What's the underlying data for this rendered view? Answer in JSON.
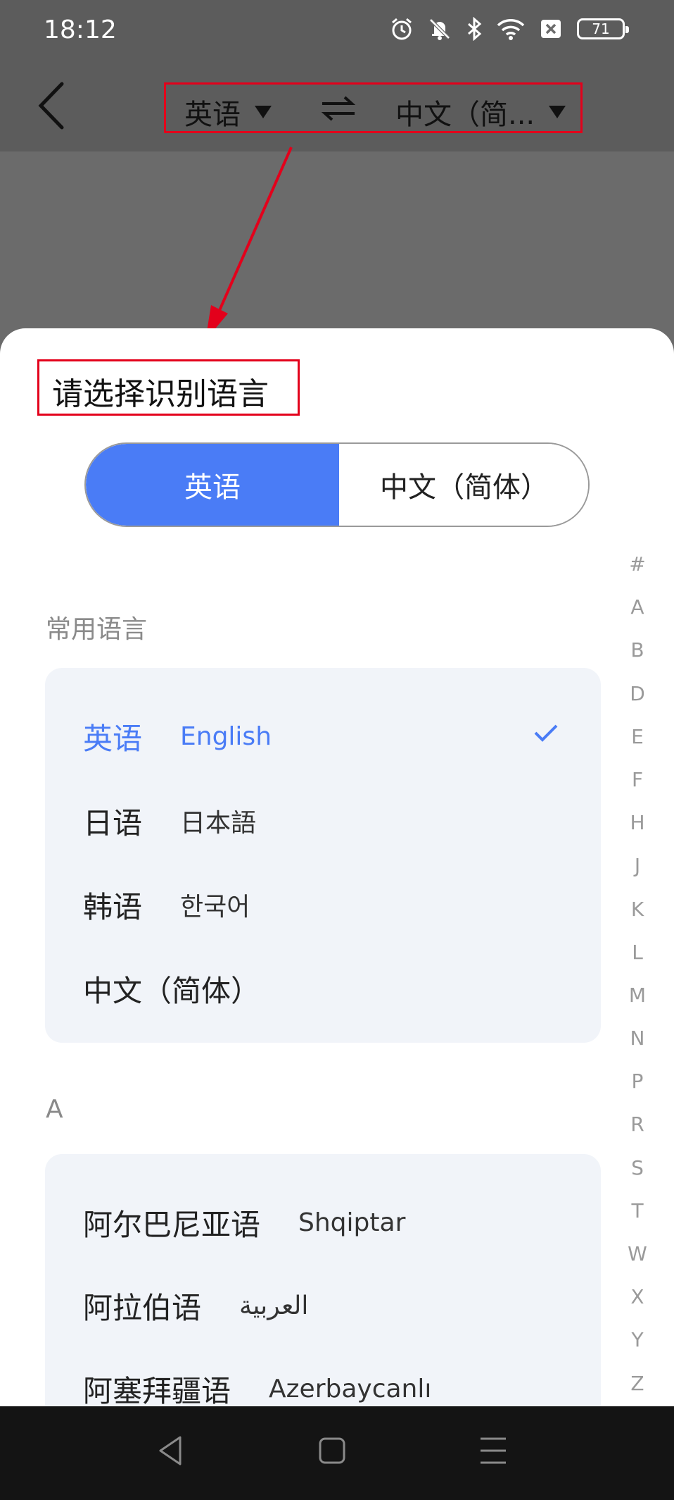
{
  "status": {
    "time": "18:12",
    "battery": "71"
  },
  "header": {
    "source_lang": "英语",
    "target_lang": "中文（简..."
  },
  "sheet": {
    "title": "请选择识别语言",
    "tabs": [
      "英语",
      "中文（简体）"
    ],
    "sections": [
      {
        "label": "常用语言",
        "items": [
          {
            "name": "英语",
            "native": "English",
            "selected": true
          },
          {
            "name": "日语",
            "native": "日本語"
          },
          {
            "name": "韩语",
            "native": "한국어"
          },
          {
            "name": "中文（简体）",
            "native": ""
          }
        ]
      },
      {
        "label": "A",
        "items": [
          {
            "name": "阿尔巴尼亚语",
            "native": "Shqiptar"
          },
          {
            "name": "阿拉伯语",
            "native": "العربية"
          },
          {
            "name": "阿塞拜疆语",
            "native": "Azerbaycanlı"
          }
        ]
      }
    ]
  },
  "index_letters": [
    "#",
    "A",
    "B",
    "D",
    "E",
    "F",
    "H",
    "J",
    "K",
    "L",
    "M",
    "N",
    "P",
    "R",
    "S",
    "T",
    "W",
    "X",
    "Y",
    "Z"
  ],
  "colors": {
    "accent": "#4a7cf6",
    "highlight": "#e3001b",
    "card_bg": "#f1f4f9"
  }
}
